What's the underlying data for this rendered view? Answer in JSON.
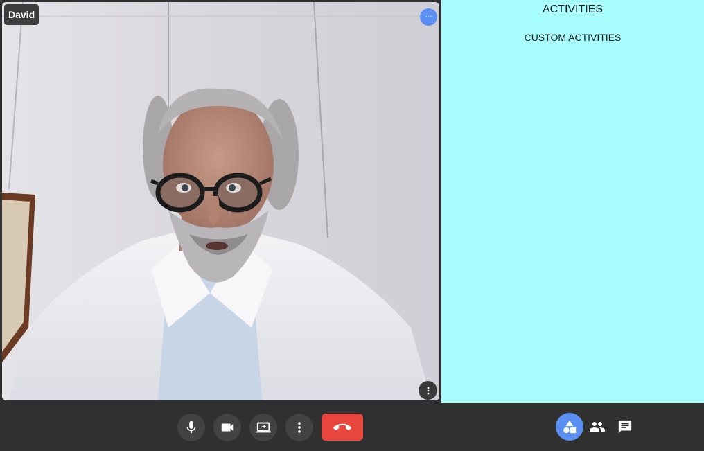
{
  "participant": {
    "name": "David",
    "status_indicator": "···"
  },
  "activities_panel": {
    "title": "ACTIVITIES",
    "subtitle": "CUSTOM ACTIVITIES",
    "background_color": "#a8fefe"
  },
  "controls": {
    "icons": [
      "mic-icon",
      "camera-icon",
      "present-screen-icon",
      "more-vert-icon",
      "hang-up-icon"
    ],
    "hangup_color": "#e8453c"
  },
  "side_controls": {
    "icons": [
      "activities-icon",
      "people-icon",
      "chat-icon"
    ],
    "active_color": "#5c8ff2"
  }
}
